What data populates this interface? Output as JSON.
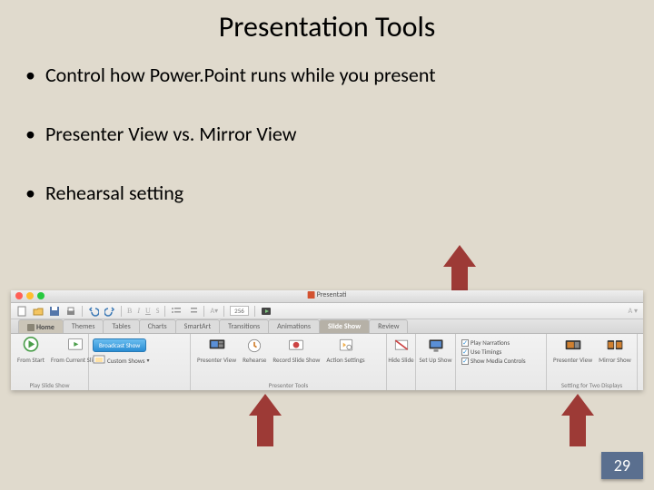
{
  "title": "Presentation Tools",
  "bullets": [
    "Control how Power.Point runs while you present",
    "Presenter View vs. Mirror View",
    "Rehearsal setting"
  ],
  "page_number": "29",
  "toolbar": {
    "doc_title": "Presentati",
    "zoom": "256",
    "tabs": [
      "Home",
      "Themes",
      "Tables",
      "Charts",
      "SmartArt",
      "Transitions",
      "Animations",
      "Slide Show",
      "Review"
    ],
    "active_tab": "Slide Show",
    "groups": {
      "play": {
        "caption": "Play Slide Show",
        "from_start": "From Start",
        "from_current": "From Current Slide"
      },
      "broadcast": {
        "broadcast_btn": "Broadcast Show",
        "custom_shows": "Custom Shows"
      },
      "presenter": {
        "caption": "Presenter Tools",
        "presenter_view": "Presenter View",
        "rehearse": "Rehearse",
        "record": "Record Slide Show",
        "action": "Action Settings"
      },
      "hide": {
        "hide_slide": "Hide Slide"
      },
      "setup": {
        "setup_show": "Set Up Show"
      },
      "checks": {
        "play_narrations": "Play Narrations",
        "use_timings": "Use Timings",
        "show_media": "Show Media Controls"
      },
      "displays": {
        "caption": "Setting for Two Displays",
        "presenter_view": "Presenter View",
        "mirror_show": "Mirror Show"
      }
    }
  }
}
